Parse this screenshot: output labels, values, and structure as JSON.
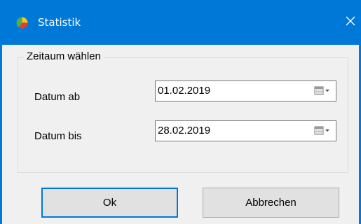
{
  "window": {
    "title": "Statistik",
    "close_symbol": "×",
    "icon": "pie-chart-icon",
    "accent_color": "#0078d7"
  },
  "group": {
    "legend": "Zeitaum wählen"
  },
  "fields": {
    "from_label": "Datum ab",
    "from_value": "01.02.2019",
    "to_label": "Datum bis",
    "to_value": "28.02.2019",
    "picker_icon": "calendar-dropdown-icon"
  },
  "buttons": {
    "ok": "Ok",
    "cancel": "Abbrechen"
  }
}
